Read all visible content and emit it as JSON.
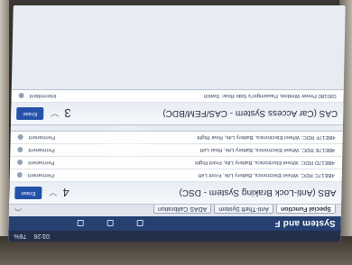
{
  "status_bar": {
    "time": "03:26",
    "battery": "76%"
  },
  "header": {
    "title": "System and F"
  },
  "tabs": [
    {
      "label": "Special Function"
    },
    {
      "label": "Anti-Theft System"
    },
    {
      "label": "ADAS Calibration"
    }
  ],
  "groups": [
    {
      "title": "ABS (Anti-Lock Braking System - DSC)",
      "count": "4",
      "button": "Erase",
      "rows": [
        {
          "label": "4BE17C RDC: Wheel Electronics, Battery Life, Front Left",
          "status": "Permanent"
        },
        {
          "label": "4BE17D RDC: Wheel Electronics, Battery Life, Front Right",
          "status": "Permanent"
        },
        {
          "label": "4BE17E RDC: Wheel Electronics, Battery Life, Rear Left",
          "status": "Permanent"
        },
        {
          "label": "4BE17F RDC: Wheel Electronics, Battery Life, Rear Right",
          "status": "Permanent"
        }
      ]
    },
    {
      "title": "CAS (Car Access System - CAS/FEM/BDC)",
      "count": "3",
      "button": "Erase",
      "rows": [
        {
          "label": "030180 Power Window, Passenger's Side Rear: Switch",
          "status": "Intermittent"
        }
      ]
    }
  ]
}
